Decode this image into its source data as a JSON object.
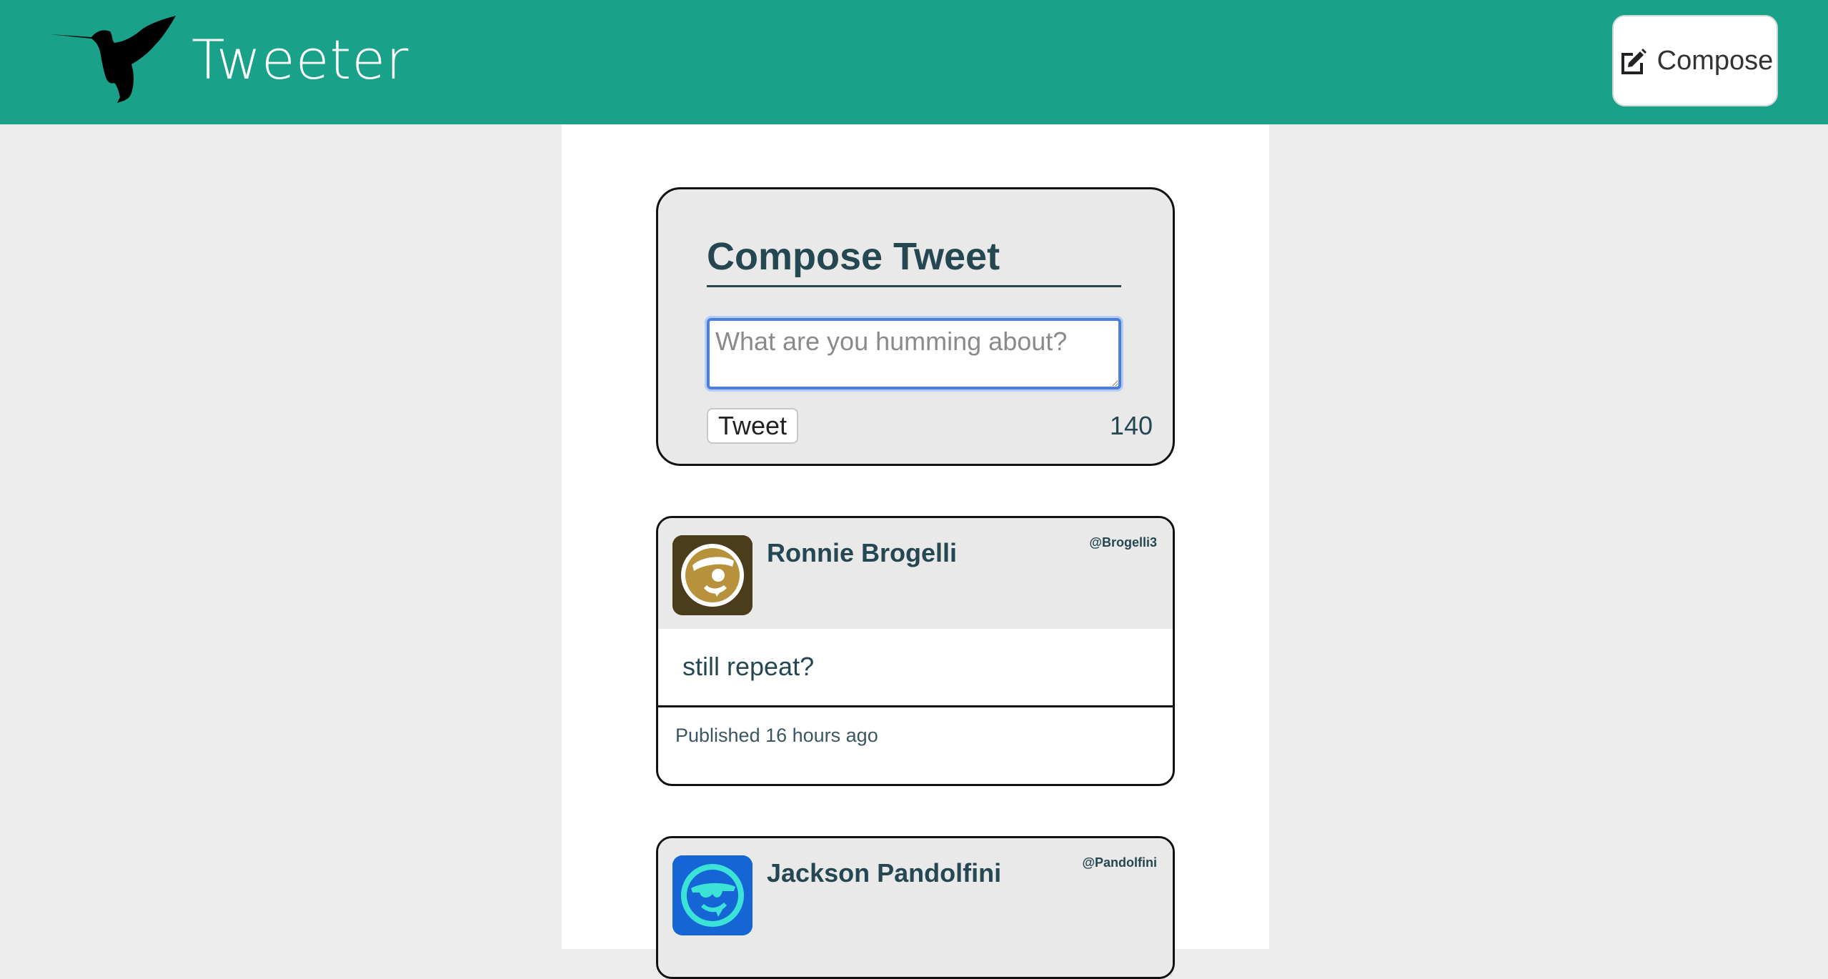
{
  "header": {
    "brand": "Tweeter",
    "logo_icon": "hummingbird-icon",
    "compose_label": "Compose",
    "compose_icon": "edit-square-icon",
    "bar_color": "#19a189"
  },
  "compose": {
    "title": "Compose Tweet",
    "placeholder": "What are you humming about?",
    "value": "",
    "button_label": "Tweet",
    "char_count": "140"
  },
  "tweets": [
    {
      "name": "Ronnie Brogelli",
      "handle": "@Brogelli3",
      "text": "still repeat?",
      "published": "Published 16 hours ago",
      "avatar_icon": "pirate-face-avatar",
      "avatar_color": "#4b3d1c"
    },
    {
      "name": "Jackson Pandolfini",
      "handle": "@Pandolfini",
      "avatar_icon": "sunglasses-face-avatar",
      "avatar_color": "#1565d6"
    }
  ]
}
